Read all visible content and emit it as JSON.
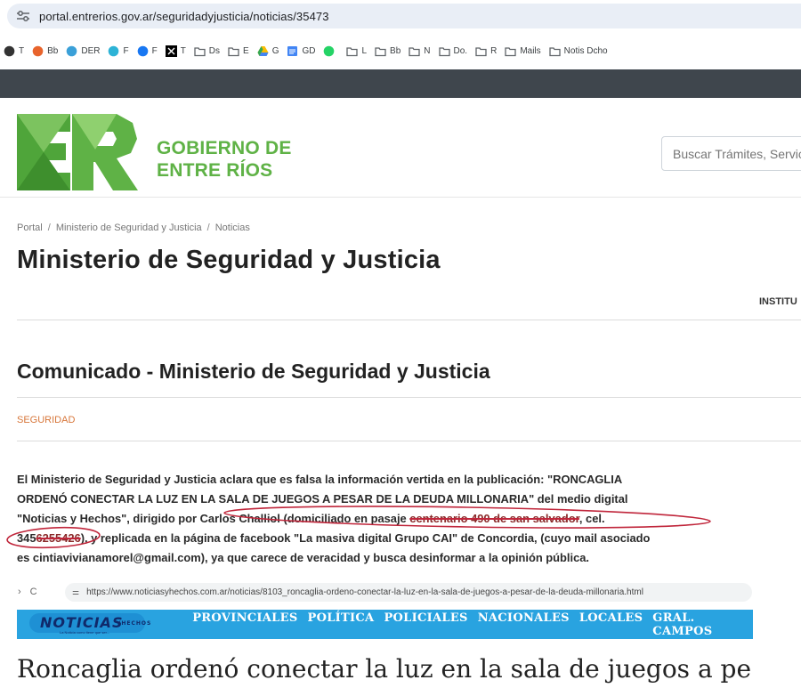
{
  "browser": {
    "url": "portal.entrerios.gov.ar/seguridadyjusticia/noticias/35473",
    "bookmarks": [
      {
        "label": "T",
        "icon": "github-icon",
        "color": "#333333"
      },
      {
        "label": "Bb",
        "icon": "blue-badge-icon",
        "color": "#e8642c"
      },
      {
        "label": "DER",
        "icon": "spiral-icon",
        "color": "#3aa0d8"
      },
      {
        "label": "F",
        "icon": "circle-f-icon",
        "color": "#2db3d6"
      },
      {
        "label": "F",
        "icon": "facebook-icon",
        "color": "#1877f2"
      },
      {
        "label": "T",
        "icon": "x-icon",
        "color": "#000000"
      },
      {
        "label": "Ds",
        "icon": "folder-icon",
        "color": "#5f6368"
      },
      {
        "label": "E",
        "icon": "folder-icon",
        "color": "#5f6368"
      },
      {
        "label": "G",
        "icon": "google-drive-icon",
        "color": "#34a853"
      },
      {
        "label": "GD",
        "icon": "google-docs-icon",
        "color": "#4285f4"
      },
      {
        "label": "",
        "icon": "whatsapp-icon",
        "color": "#25d366"
      },
      {
        "label": "L",
        "icon": "folder-icon",
        "color": "#5f6368"
      },
      {
        "label": "Bb",
        "icon": "folder-icon",
        "color": "#5f6368"
      },
      {
        "label": "N",
        "icon": "folder-icon",
        "color": "#5f6368"
      },
      {
        "label": "Do.",
        "icon": "folder-icon",
        "color": "#5f6368"
      },
      {
        "label": "R",
        "icon": "folder-icon",
        "color": "#5f6368"
      },
      {
        "label": "Mails",
        "icon": "folder-icon",
        "color": "#5f6368"
      },
      {
        "label": "Notis Dcho",
        "icon": "folder-icon",
        "color": "#5f6368"
      }
    ]
  },
  "header": {
    "gov_line1": "GOBIERNO DE",
    "gov_line2": "ENTRE RÍOS",
    "search_placeholder": "Buscar Trámites, Servicios",
    "brand_green": "#5fb246"
  },
  "breadcrumb": [
    "Portal",
    "Ministerio de Seguridad y Justicia",
    "Noticias"
  ],
  "page_title": "Ministerio de Seguridad y Justicia",
  "nav_item": "INSTITU",
  "article": {
    "title": "Comunicado - Ministerio de Seguridad y Justicia",
    "category": "SEGURIDAD",
    "p1": "El Ministerio de Seguridad y Justicia aclara que es falsa la información vertida en la publicación: \"RONCAGLIA",
    "p2": "ORDENÓ CONECTAR LA LUZ EN LA SALA DE JUEGOS A PESAR DE LA DEUDA MILLONARIA\" del medio digital",
    "p3a": "\"Noticias y Hechos\",  dirigido por Carlos Challiol (domiciliado en pasaje ",
    "p3strike": "centenario 490 de san salvador",
    "p3b": ", cel.",
    "p4a": "345",
    "p4strike": "6255426",
    "p4b": "), y replicada en la página de facebook \"La masiva digital Grupo CAI\" de Concordia, (cuyo mail asociado",
    "p5": "es cintiavivianamorel@gmail.com), ya que carece de veracidad y busca desinformar a la opinión pública."
  },
  "embed": {
    "url": "https://www.noticiasyhechos.com.ar/noticias/8103_roncaglia-ordeno-conectar-la-luz-en-la-sala-de-juegos-a-pesar-de-la-deuda-millonaria.html",
    "logo_text": "NOTICIAS",
    "logo_suffix": "YHECHOS",
    "logo_tag": "La Noticia como tiene que ser...",
    "menu": [
      "PROVINCIALES",
      "POLÍTICA",
      "POLICIALES",
      "NACIONALES",
      "LOCALES",
      "GRAL. CAMPOS"
    ],
    "headline": "Roncaglia ordenó conectar la luz en la sala de juegos a pe",
    "menu_color": "#29a3e0"
  }
}
